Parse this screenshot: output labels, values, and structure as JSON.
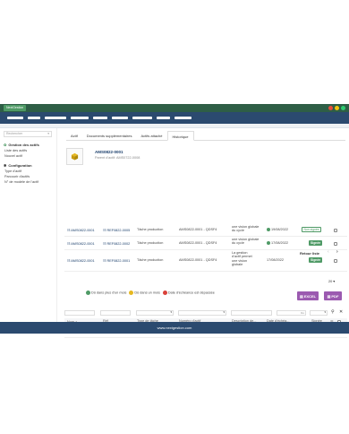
{
  "app": {
    "brand": "NextGestion",
    "window_dots": [
      "#e74c3c",
      "#f1c40f",
      "#2ecc71"
    ],
    "accent": "#4f9a66",
    "nav_color": "#2b4a6f"
  },
  "sidebar": {
    "search_placeholder": "Rechercher",
    "sections": [
      {
        "title": "Gestion des actifs",
        "items": [
          "Liste des actifs",
          "Nouvel actif"
        ]
      },
      {
        "title": "Configuration",
        "items": [
          "Type d'actif",
          "Parcourir d'actifs",
          "N° de modèle de l'actif"
        ]
      }
    ]
  },
  "tabs": [
    "Actif",
    "Documents supplémentaires",
    "Actifs attaché",
    "Historique"
  ],
  "active_tab": "Historique",
  "asset": {
    "code": "AMS0822-0001",
    "parent": "Parent d'actif: AMS0722-0008"
  },
  "navigation": {
    "back": "Retour liste",
    "prev": "‹",
    "next": "›"
  },
  "page_size": "20",
  "legend": [
    {
      "label": "Dû dans plus d'un mois",
      "color": "#4f9a66"
    },
    {
      "label": "Dû dans un mois",
      "color": "#e6b820"
    },
    {
      "label": "Date d'échéance est dépassée",
      "color": "#d9413a"
    }
  ],
  "buttons": {
    "excel": "EXCEL",
    "pdf": "PDF"
  },
  "filter_placeholder": "Ré",
  "table": {
    "headers": [
      "Nom",
      "Réf",
      "Type de tâche",
      "Numéro d'actif",
      "Description de...",
      "Date d'échéa...",
      "Signée"
    ],
    "rows": [
      {
        "name": "AMS0822-0001",
        "ref": "REF0822-0005",
        "type": "Tâche production",
        "asset_no": "AMS0822-0001 - QDSF4",
        "description": "une vision globale du cycle",
        "due_date": "19/08/2022",
        "signed": "Non signée",
        "signed_style": "outline"
      },
      {
        "name": "AMS0822-0001",
        "ref": "REF0822-0002",
        "type": "Tâche production",
        "asset_no": "AMS0822-0001 - QDSF4",
        "description": "une vision globale du cycle",
        "due_date": "17/08/2022",
        "signed": "Signée",
        "signed_style": "fill"
      },
      {
        "name": "AMS0822-0001",
        "ref": "REF0822-0001",
        "type": "Tâche production",
        "asset_no": "AMS0822-0001 - QDSF4",
        "description": "La gestion d'actif permet une vision globale",
        "due_date": "17/08/2022",
        "signed": "Signée",
        "signed_style": "fill"
      }
    ]
  },
  "footer": "www.nextgestion.com"
}
